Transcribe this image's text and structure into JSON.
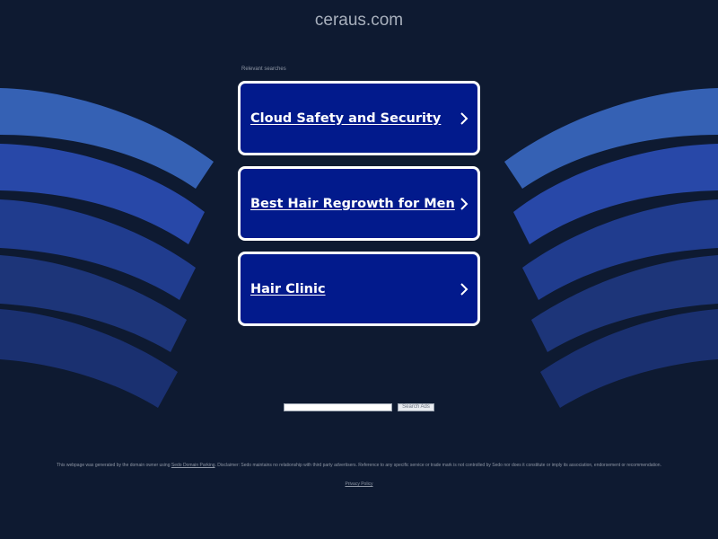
{
  "header": {
    "domain": "ceraus.com"
  },
  "related": {
    "label": "Relevant searches",
    "links": [
      {
        "text": "Cloud Safety and Security"
      },
      {
        "text": "Best Hair Regrowth for Men"
      },
      {
        "text": "Hair Clinic"
      }
    ]
  },
  "search": {
    "input_value": "",
    "button_label": "Search Ads"
  },
  "footer": {
    "text_before": "This webpage was generated by the domain owner using ",
    "parking_link": "Sedo Domain Parking",
    "text_after": ". Disclaimer: Sedo maintains no relationship with third party advertisers. Reference to any specific service or trade mark is not controlled by Sedo nor does it constitute or imply its association, endorsement or recommendation.",
    "privacy_link": "Privacy Policy"
  },
  "colors": {
    "background": "#0e1a31",
    "card_fill": "#021a8c",
    "card_border": "#ffffff",
    "wave_light": "#3561b4",
    "wave_mid": "#2848a8",
    "wave_dark": "#1d3579"
  },
  "icons": {
    "link_arrow": "chevron-right-icon"
  }
}
